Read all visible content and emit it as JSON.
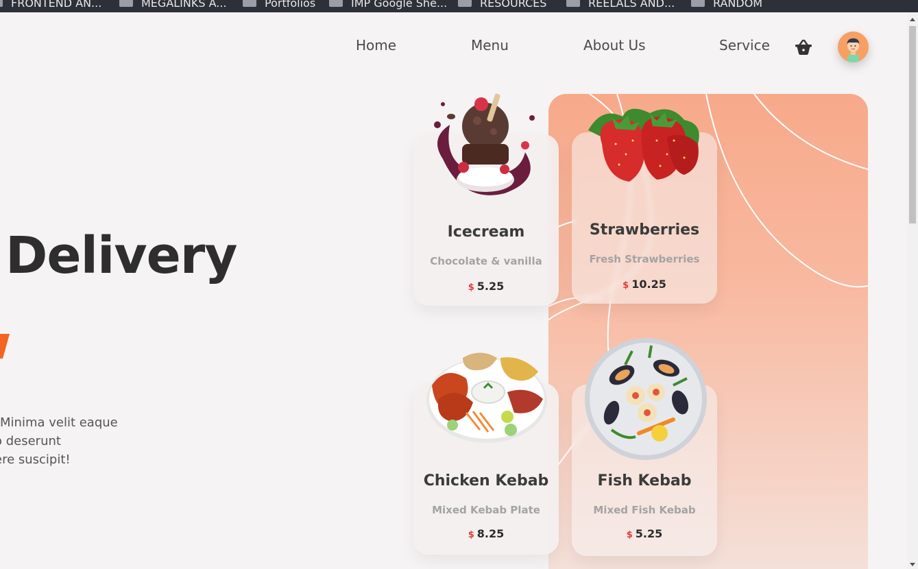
{
  "bookmarks": [
    {
      "label": "FRONTEND AN..."
    },
    {
      "label": "MEGALINKS A..."
    },
    {
      "label": "Portfolios"
    },
    {
      "label": "IMP Google She..."
    },
    {
      "label": "RESOURCES"
    },
    {
      "label": "REELALS AND..."
    },
    {
      "label": "RANDOM"
    }
  ],
  "nav": {
    "home": "Home",
    "menu": "Menu",
    "about": "About Us",
    "service": "Service",
    "cart_icon": "basket-icon",
    "avatar_icon": "user-avatar-icon"
  },
  "hero": {
    "title": "Delivery",
    "text_lines": [
      "Minima velit eaque",
      "o deserunt",
      "ere suscipit!"
    ]
  },
  "cards": [
    {
      "name": "Icecream",
      "desc": "Chocolate & vanilla",
      "currency": "$",
      "price": "5.25",
      "image": "icecream-image"
    },
    {
      "name": "Strawberries",
      "desc": "Fresh Strawberries",
      "currency": "$",
      "price": "10.25",
      "image": "strawberries-image"
    },
    {
      "name": "Chicken Kebab",
      "desc": "Mixed Kebab Plate",
      "currency": "$",
      "price": "8.25",
      "image": "chicken-kebab-image"
    },
    {
      "name": "Fish Kebab",
      "desc": "Mixed Fish Kebab",
      "currency": "$",
      "price": "5.25",
      "image": "fish-kebab-image"
    }
  ],
  "colors": {
    "accent_orange": "#f26522",
    "price_currency": "#e23b3b",
    "panel_peach": "#f7a98a"
  }
}
